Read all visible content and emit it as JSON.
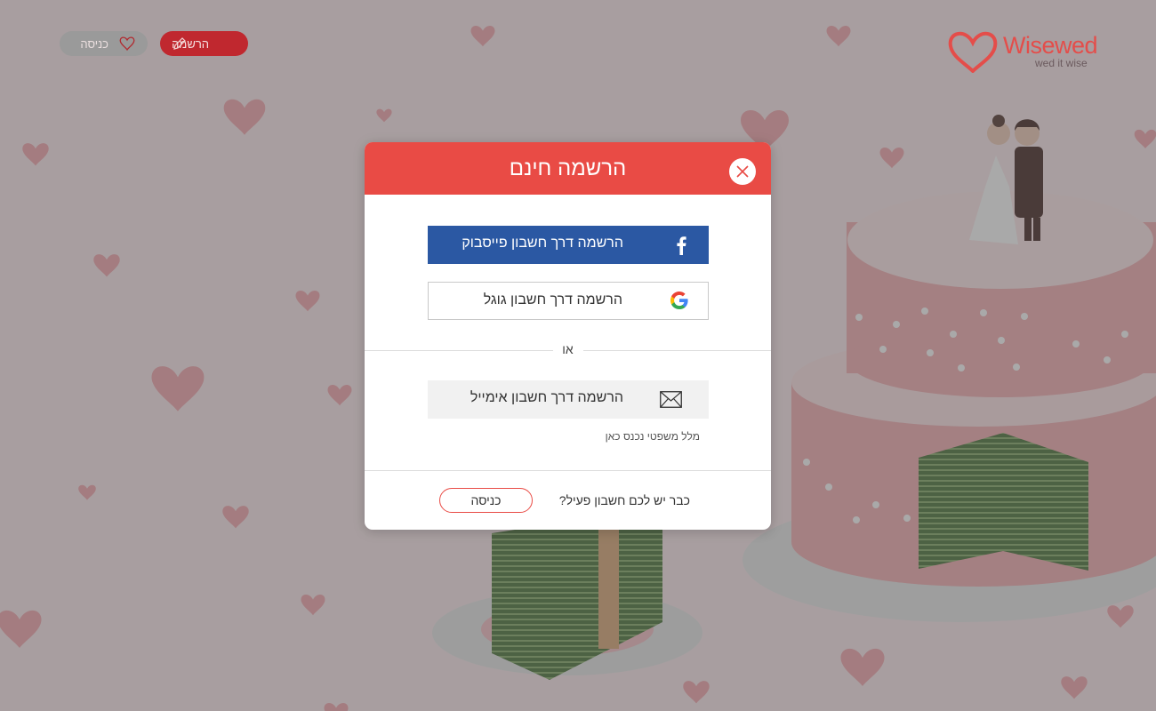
{
  "header": {
    "logo_word": "Wisewed",
    "logo_tagline": "wed it wise",
    "signup_label": "הרשמה",
    "login_label": "כניסה"
  },
  "modal": {
    "title": "הרשמה חינם",
    "facebook_label": "הרשמה דרך חשבון פייסבוק",
    "google_label": "הרשמה דרך חשבון גוגל",
    "or_label": "או",
    "email_label": "הרשמה דרך חשבון אימייל",
    "terms_label": "מלל משפטי נכנס כאן",
    "footer_question": "כבר יש לכם חשבון פעיל?",
    "footer_login_label": "כניסה"
  },
  "icons": {
    "close": "close-icon",
    "facebook": "facebook-icon",
    "google": "google-icon",
    "email": "envelope-icon",
    "pencil": "pencil-icon",
    "heart": "heart-icon"
  },
  "colors": {
    "accent": "#e94b45",
    "facebook": "#2b58a3",
    "signup_btn": "#c0282f"
  }
}
